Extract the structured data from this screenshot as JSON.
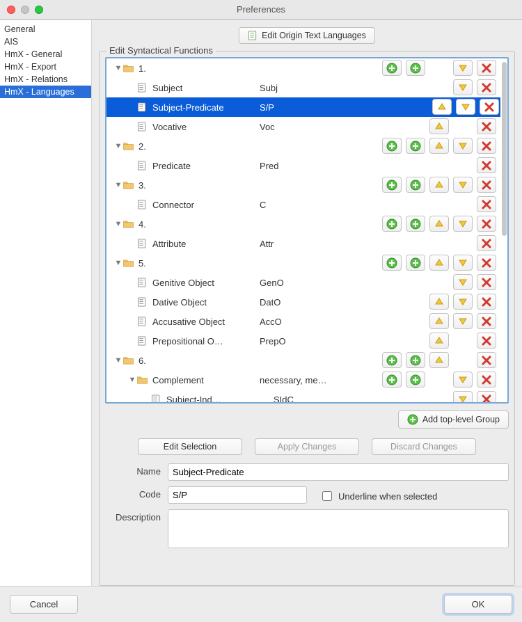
{
  "window": {
    "title": "Preferences"
  },
  "sidebar": {
    "items": [
      {
        "label": "General",
        "selected": false
      },
      {
        "label": "AIS",
        "selected": false
      },
      {
        "label": "HmX - General",
        "selected": false
      },
      {
        "label": "HmX - Export",
        "selected": false
      },
      {
        "label": "HmX - Relations",
        "selected": false
      },
      {
        "label": "HmX - Languages",
        "selected": true
      }
    ]
  },
  "top_button": {
    "label": "Edit Origin Text Languages"
  },
  "groupbox": {
    "title": "Edit Syntactical Functions"
  },
  "rows": [
    {
      "type": "group",
      "level": 0,
      "disclosure": "▼",
      "label": "1.",
      "code": "",
      "actions": [
        "plus",
        "plus",
        "",
        "down",
        "del"
      ]
    },
    {
      "type": "item",
      "level": 1,
      "label": "Subject",
      "code": "Subj",
      "actions": [
        "",
        "",
        "",
        "down",
        "del"
      ]
    },
    {
      "type": "item",
      "level": 1,
      "label": "Subject-Predicate",
      "code": "S/P",
      "selected": true,
      "actions": [
        "",
        "",
        "up",
        "down",
        "del"
      ]
    },
    {
      "type": "item",
      "level": 1,
      "label": "Vocative",
      "code": "Voc",
      "actions": [
        "",
        "",
        "up",
        "",
        "del"
      ]
    },
    {
      "type": "group",
      "level": 0,
      "disclosure": "▼",
      "label": "2.",
      "code": "",
      "actions": [
        "plus",
        "plus",
        "up",
        "down",
        "del"
      ]
    },
    {
      "type": "item",
      "level": 1,
      "label": "Predicate",
      "code": "Pred",
      "actions": [
        "",
        "",
        "",
        "",
        "del"
      ]
    },
    {
      "type": "group",
      "level": 0,
      "disclosure": "▼",
      "label": "3.",
      "code": "",
      "actions": [
        "plus",
        "plus",
        "up",
        "down",
        "del"
      ]
    },
    {
      "type": "item",
      "level": 1,
      "label": "Connector",
      "code": "C",
      "actions": [
        "",
        "",
        "",
        "",
        "del"
      ]
    },
    {
      "type": "group",
      "level": 0,
      "disclosure": "▼",
      "label": "4.",
      "code": "",
      "actions": [
        "plus",
        "plus",
        "up",
        "down",
        "del"
      ]
    },
    {
      "type": "item",
      "level": 1,
      "label": "Attribute",
      "code": "Attr",
      "actions": [
        "",
        "",
        "",
        "",
        "del"
      ]
    },
    {
      "type": "group",
      "level": 0,
      "disclosure": "▼",
      "label": "5.",
      "code": "",
      "actions": [
        "plus",
        "plus",
        "up",
        "down",
        "del"
      ]
    },
    {
      "type": "item",
      "level": 1,
      "label": "Genitive Object",
      "code": "GenO",
      "actions": [
        "",
        "",
        "",
        "down",
        "del"
      ]
    },
    {
      "type": "item",
      "level": 1,
      "label": "Dative Object",
      "code": "DatO",
      "actions": [
        "",
        "",
        "up",
        "down",
        "del"
      ]
    },
    {
      "type": "item",
      "level": 1,
      "label": "Accusative Object",
      "code": "AccO",
      "actions": [
        "",
        "",
        "up",
        "down",
        "del"
      ]
    },
    {
      "type": "item",
      "level": 1,
      "label": "Prepositional O…",
      "code": "PrepO",
      "actions": [
        "",
        "",
        "up",
        "",
        "del"
      ]
    },
    {
      "type": "group",
      "level": 0,
      "disclosure": "▼",
      "label": "6.",
      "code": "",
      "actions": [
        "plus",
        "plus",
        "up",
        "",
        "del"
      ]
    },
    {
      "type": "sub",
      "level": 1,
      "disclosure": "▼",
      "label": "Complement",
      "code": "necessary, mea…",
      "actions": [
        "plus",
        "plus",
        "",
        "down",
        "del"
      ]
    },
    {
      "type": "item",
      "level": 2,
      "label": "Subject-Ind…",
      "code": "SIdC",
      "actions": [
        "",
        "",
        "",
        "down",
        "del"
      ]
    }
  ],
  "add_group_button": {
    "label": "Add top-level Group"
  },
  "edit_buttons": {
    "edit": "Edit Selection",
    "apply": "Apply Changes",
    "discard": "Discard Changes"
  },
  "form": {
    "name_label": "Name",
    "name_value": "Subject-Predicate",
    "code_label": "Code",
    "code_value": "S/P",
    "underline_label": "Underline when selected",
    "underline_checked": false,
    "description_label": "Description",
    "description_value": ""
  },
  "footer": {
    "cancel": "Cancel",
    "ok": "OK"
  }
}
